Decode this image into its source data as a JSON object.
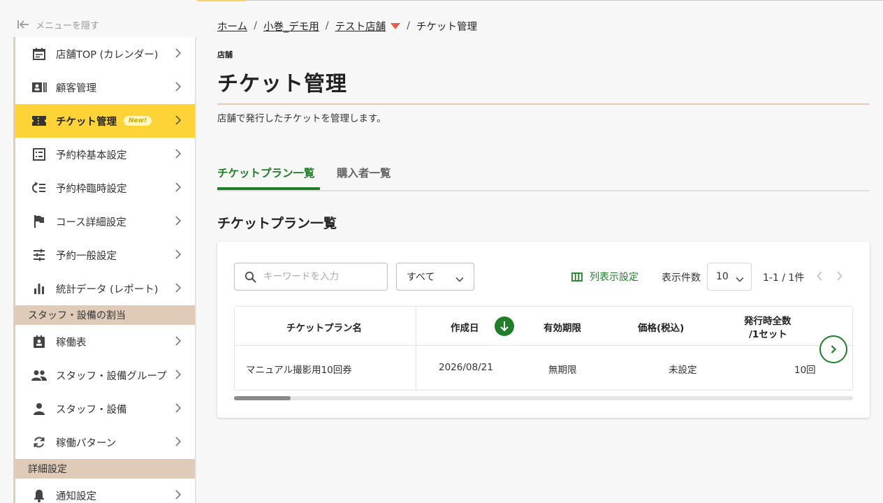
{
  "sidebar": {
    "hide_menu_label": "メニューを隠す",
    "items": [
      {
        "label": "店舗TOP (カレンダー)",
        "icon": "calendar-icon"
      },
      {
        "label": "顧客管理",
        "icon": "contact-card-icon"
      },
      {
        "label": "チケット管理",
        "icon": "ticket-icon",
        "badge": "New!",
        "active": true
      },
      {
        "label": "予約枠基本設定",
        "icon": "list-icon"
      },
      {
        "label": "予約枠臨時設定",
        "icon": "temp-settings-icon"
      },
      {
        "label": "コース詳細設定",
        "icon": "flag-icon"
      },
      {
        "label": "予約一般設定",
        "icon": "sliders-icon"
      },
      {
        "label": "統計データ (レポート)",
        "icon": "bar-chart-icon"
      }
    ],
    "section_staff": "スタッフ・設備の割当",
    "staff_items": [
      {
        "label": "稼働表",
        "icon": "schedule-icon"
      },
      {
        "label": "スタッフ・設備グループ",
        "icon": "group-icon"
      },
      {
        "label": "スタッフ・設備",
        "icon": "person-icon"
      },
      {
        "label": "稼働パターン",
        "icon": "sync-icon"
      }
    ],
    "section_detail": "詳細設定",
    "detail_items": [
      {
        "label": "通知設定",
        "icon": "bell-icon"
      }
    ]
  },
  "breadcrumb": {
    "home": "ホーム",
    "org": "小巻_デモ用",
    "store": "テスト店舗",
    "current": "チケット管理"
  },
  "page": {
    "label": "店舗",
    "title": "チケット管理",
    "description": "店舗で発行したチケットを管理します。"
  },
  "tabs": {
    "plans": "チケットプラン一覧",
    "buyers": "購入者一覧"
  },
  "section_title": "チケットプラン一覧",
  "toolbar": {
    "search_placeholder": "キーワードを入力",
    "filter_value": "すべて",
    "column_settings": "列表示設定",
    "per_page_label": "表示件数",
    "per_page_value": "10",
    "page_info": "1-1 / 1件"
  },
  "table": {
    "headers": {
      "name": "チケットプラン名",
      "created": "作成日",
      "validity": "有効期限",
      "price": "価格(税込)",
      "total_line1": "発行時全数",
      "total_line2": "/1セット"
    },
    "rows": [
      {
        "name": "マニュアル撮影用10回券",
        "created": "2026/08/21",
        "validity": "無期限",
        "price": "未設定",
        "total": "10回"
      }
    ]
  },
  "colors": {
    "accent_green": "#1f7f28",
    "active_yellow": "#fdd335",
    "section_tan": "#dfcbb8",
    "breadcrumb_triangle": "#e8604c"
  }
}
